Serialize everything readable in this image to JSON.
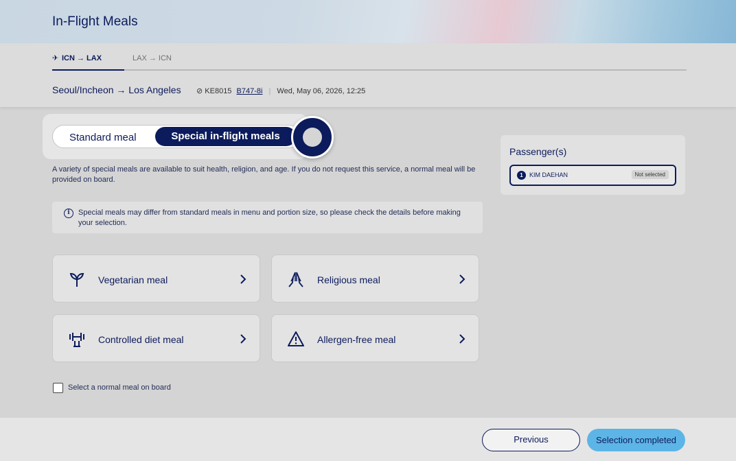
{
  "page": {
    "title": "In-Flight Meals"
  },
  "tabs": [
    {
      "label": "ICN → LAX",
      "active": true
    },
    {
      "label": "LAX → ICN",
      "active": false
    }
  ],
  "flight": {
    "route": "Seoul/Incheon → Los Angeles",
    "number": "KE8015",
    "aircraft": "B747-8i",
    "datetime": "Wed, May 06, 2026, 12:25"
  },
  "meal_toggle": {
    "standard_label": "Standard meal",
    "special_label": "Special in-flight meals",
    "selected": "special"
  },
  "description": "A variety of special meals are available to suit health, religion, and age. If you do not request this service, a normal meal will be provided on board.",
  "notice": "Special meals may differ from standard meals in menu and portion size, so please check the details before making your selection.",
  "categories": [
    {
      "label": "Vegetarian meal",
      "icon": "sprout-icon"
    },
    {
      "label": "Religious meal",
      "icon": "praying-hands-icon"
    },
    {
      "label": "Controlled diet meal",
      "icon": "dumbbell-icon"
    },
    {
      "label": "Allergen-free meal",
      "icon": "warning-icon"
    }
  ],
  "normal_meal_checkbox": {
    "label": "Select a normal meal on board",
    "checked": false
  },
  "passengers": {
    "title": "Passenger(s)",
    "list": [
      {
        "number": "1",
        "name": "KIM DAEHAN",
        "status": "Not selected"
      }
    ]
  },
  "footer": {
    "previous_label": "Previous",
    "complete_label": "Selection completed"
  },
  "colors": {
    "primary": "#0c1b5c",
    "accent": "#5cb5e6"
  }
}
